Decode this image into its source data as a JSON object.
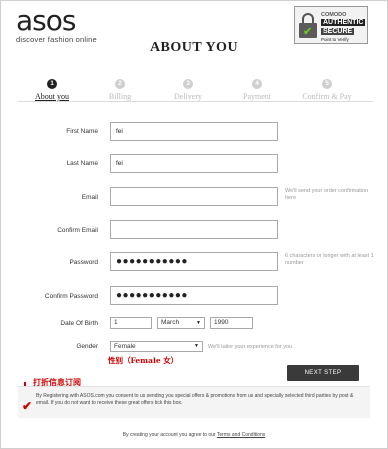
{
  "brand": {
    "name": "asos",
    "tagline": "discover fashion online"
  },
  "security_badge": {
    "line1": "COMODO",
    "line2": "AUTHENTIC",
    "line3": "SECURE",
    "line4": "Point to Verify"
  },
  "page_title": "ABOUT YOU",
  "steps": [
    {
      "number": "1",
      "label": "About you",
      "active": true
    },
    {
      "number": "2",
      "label": "Billing",
      "active": false
    },
    {
      "number": "3",
      "label": "Delivery",
      "active": false
    },
    {
      "number": "4",
      "label": "Payment",
      "active": false
    },
    {
      "number": "5",
      "label": "Confirm & Pay",
      "active": false
    }
  ],
  "form": {
    "first_name": {
      "label": "First Name",
      "value": "fei"
    },
    "last_name": {
      "label": "Last Name",
      "value": "fei"
    },
    "email": {
      "label": "Email",
      "value": "",
      "hint": "We'll send your order confirmation here"
    },
    "confirm_email": {
      "label": "Confirm Email",
      "value": ""
    },
    "password": {
      "label": "Password",
      "value": "●●●●●●●●●●●",
      "hint": "6 characters or longer with at least 1 number"
    },
    "confirm_password": {
      "label": "Confirm Password",
      "value": "●●●●●●●●●●●"
    },
    "dob": {
      "label": "Date Of Birth",
      "day": "1",
      "month": "March",
      "year": "1990"
    },
    "gender": {
      "label": "Gender",
      "value": "Female",
      "hint": "We'll tailor your experience for you"
    }
  },
  "annotations": {
    "gender_note": "性别（Female 女）",
    "consent_note": "打折信息订阅"
  },
  "next_button": "NEXT STEP",
  "consent_text": "By Registering with ASOS.com you consent to us sending you special offers & promotions from us and specially selected third parties by post & email. If you do not want to receive these great offers tick this box.",
  "terms": {
    "prefix": "By creating your account you agree to our",
    "link": "Terms and Conditions"
  }
}
